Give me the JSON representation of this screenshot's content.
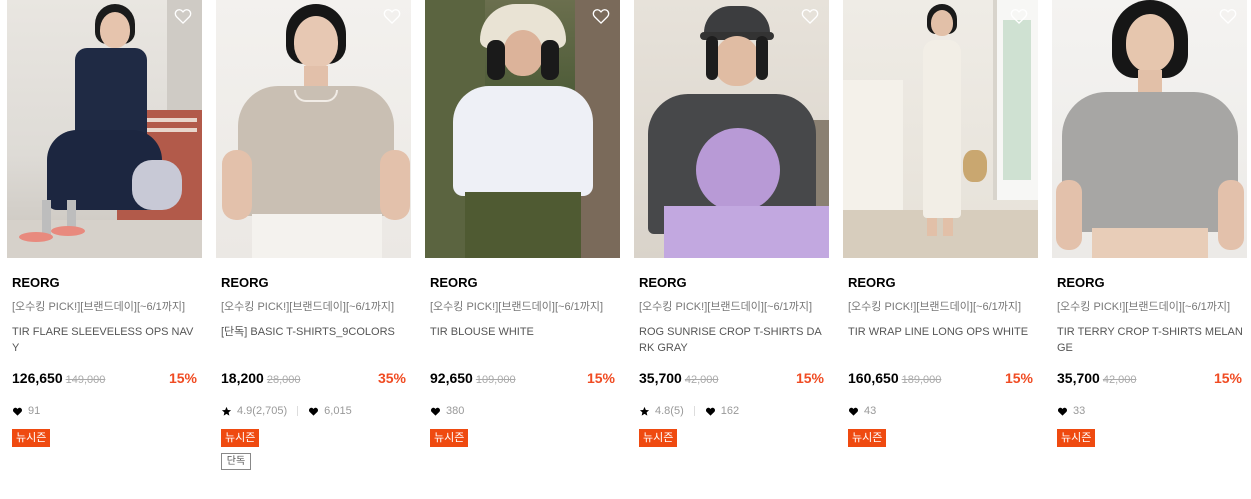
{
  "colors": {
    "accent": "#f04b22",
    "badge_bg": "#ef4a10"
  },
  "products": [
    {
      "brand": "REORG",
      "promo": "[오수킹 PICK!][브랜드데이][~6/1까지]",
      "name": "TIR FLARE SLEEVELESS OPS NAVY",
      "price": "126,650",
      "original_price": "149,000",
      "discount": "15%",
      "likes": "91",
      "badge": "뉴시즌",
      "wishlist_icon": "heart-outline-icon"
    },
    {
      "brand": "REORG",
      "promo": "[오수킹 PICK!][브랜드데이][~6/1까지]",
      "name": "[단독] BASIC T-SHIRTS_9COLORS",
      "price": "18,200",
      "original_price": "28,000",
      "discount": "35%",
      "rating": "4.9(2,705)",
      "likes": "6,015",
      "badge": "뉴시즌",
      "badge2": "단독",
      "wishlist_icon": "heart-outline-icon"
    },
    {
      "brand": "REORG",
      "promo": "[오수킹 PICK!][브랜드데이][~6/1까지]",
      "name": "TIR BLOUSE WHITE",
      "price": "92,650",
      "original_price": "109,000",
      "discount": "15%",
      "likes": "380",
      "badge": "뉴시즌",
      "wishlist_icon": "heart-outline-icon"
    },
    {
      "brand": "REORG",
      "promo": "[오수킹 PICK!][브랜드데이][~6/1까지]",
      "name": "ROG SUNRISE CROP T-SHIRTS DARK GRAY",
      "price": "35,700",
      "original_price": "42,000",
      "discount": "15%",
      "rating": "4.8(5)",
      "likes": "162",
      "badge": "뉴시즌",
      "wishlist_icon": "heart-outline-icon"
    },
    {
      "brand": "REORG",
      "promo": "[오수킹 PICK!][브랜드데이][~6/1까지]",
      "name": "TIR WRAP LINE LONG OPS WHITE",
      "price": "160,650",
      "original_price": "189,000",
      "discount": "15%",
      "likes": "43",
      "badge": "뉴시즌",
      "wishlist_icon": "heart-outline-icon"
    },
    {
      "brand": "REORG",
      "promo": "[오수킹 PICK!][브랜드데이][~6/1까지]",
      "name": "TIR TERRY CROP T-SHIRTS MELANGE",
      "price": "35,700",
      "original_price": "42,000",
      "discount": "15%",
      "likes": "33",
      "badge": "뉴시즌",
      "wishlist_icon": "heart-outline-icon"
    }
  ]
}
